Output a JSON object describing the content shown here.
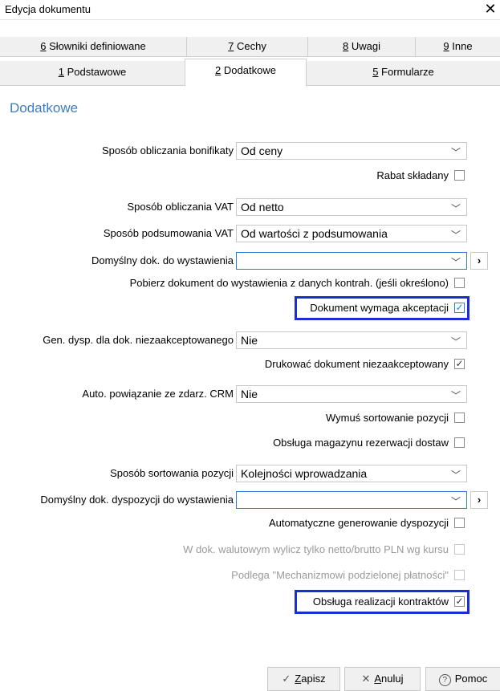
{
  "window": {
    "title": "Edycja dokumentu"
  },
  "tabs": {
    "row1": [
      {
        "key": "6",
        "label": " Słowniki definiowane"
      },
      {
        "key": "7",
        "label": " Cechy"
      },
      {
        "key": "8",
        "label": " Uwagi"
      },
      {
        "key": "9",
        "label": " Inne"
      }
    ],
    "row2": [
      {
        "key": "1",
        "label": " Podstawowe"
      },
      {
        "key": "2",
        "label": " Dodatkowe",
        "active": true
      },
      {
        "key": "5",
        "label": " Formularze"
      }
    ]
  },
  "section": {
    "title": "Dodatkowe"
  },
  "fields": {
    "bonifikaty": {
      "label": "Sposób obliczania bonifikaty",
      "value": "Od ceny"
    },
    "rabat": {
      "label": "Rabat składany",
      "checked": false
    },
    "vat": {
      "label": "Sposób obliczania VAT",
      "value": "Od netto"
    },
    "podsumowanie": {
      "label": "Sposób podsumowania VAT",
      "value": "Od wartości z podsumowania"
    },
    "domyslny": {
      "label": "Domyślny dok. do wystawienia",
      "value": ""
    },
    "pobierz": {
      "label": "Pobierz dokument do wystawienia z danych kontrah. (jeśli określono)",
      "checked": false
    },
    "akceptacja": {
      "label": "Dokument wymaga akceptacji",
      "checked": true
    },
    "gendysp": {
      "label": "Gen. dysp. dla dok. niezaakceptowanego",
      "value": "Nie"
    },
    "drukowac": {
      "label": "Drukować dokument niezaakceptowany",
      "checked": true
    },
    "crm": {
      "label": "Auto. powiązanie ze zdarz. CRM",
      "value": "Nie"
    },
    "wymus": {
      "label": "Wymuś sortowanie pozycji",
      "checked": false
    },
    "magazyn": {
      "label": "Obsługa magazynu rezerwacji dostaw",
      "checked": false
    },
    "sortowanie": {
      "label": "Sposób sortowania pozycji",
      "value": "Kolejności wprowadzania"
    },
    "domyslnydysp": {
      "label": "Domyślny dok. dyspozycji do wystawienia",
      "value": ""
    },
    "autogen": {
      "label": "Automatyczne generowanie dyspozycji",
      "checked": false
    },
    "walutowym": {
      "label": "W dok. walutowym wylicz tylko netto/brutto PLN wg kursu",
      "checked": false
    },
    "podlega": {
      "label": "Podlega \"Mechanizmowi podzielonej płatności\"",
      "checked": false
    },
    "kontrakty": {
      "label": "Obsługa realizacji kontraktów",
      "checked": true
    }
  },
  "buttons": {
    "save": {
      "icon": "✓",
      "key": "Z",
      "rest": "apisz"
    },
    "cancel": {
      "icon": "✕",
      "key": "A",
      "rest": "nuluj"
    },
    "help": {
      "icon": "?",
      "label": "Pomoc"
    }
  },
  "colors": {
    "accent": "#3b7dc4",
    "highlight": "#1b2fd0",
    "focus": "#2f7bd6"
  }
}
